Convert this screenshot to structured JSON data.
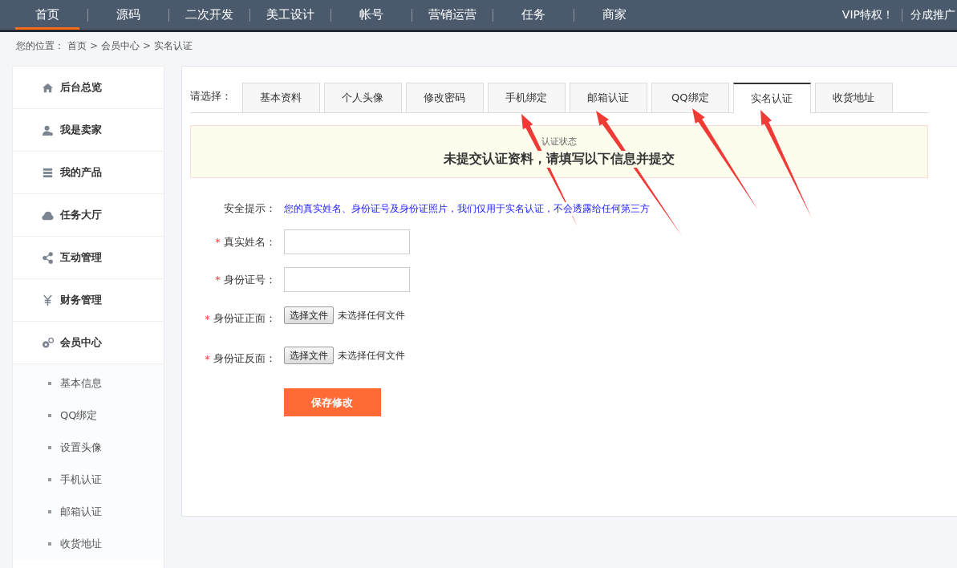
{
  "top_nav": {
    "items": [
      {
        "label": "首页",
        "selected": true
      },
      {
        "label": "源码",
        "selected": false
      },
      {
        "label": "二次开发",
        "selected": false
      },
      {
        "label": "美工设计",
        "selected": false
      },
      {
        "label": "帐号",
        "selected": false
      },
      {
        "label": "营销运营",
        "selected": false
      },
      {
        "label": "任务",
        "selected": false
      },
      {
        "label": "商家",
        "selected": false
      }
    ],
    "right_items": [
      "VIP特权！",
      "分成推广"
    ]
  },
  "breadcrumb": {
    "prefix": "您的位置：",
    "items": [
      "首页",
      "会员中心",
      "实名认证"
    ],
    "separator": ">"
  },
  "sidebar": {
    "items": [
      {
        "label": "后台总览",
        "kind": "home"
      },
      {
        "label": "我是卖家",
        "kind": "user"
      },
      {
        "label": "我的产品",
        "kind": "list"
      },
      {
        "label": "任务大厅",
        "kind": "cloud"
      },
      {
        "label": "互动管理",
        "kind": "share"
      },
      {
        "label": "财务管理",
        "kind": "yen"
      },
      {
        "label": "会员中心",
        "kind": "gears"
      }
    ],
    "sub_items": [
      "基本信息",
      "QQ绑定",
      "设置头像",
      "手机认证",
      "邮箱认证",
      "收货地址"
    ]
  },
  "tabs": {
    "label": "请选择：",
    "items": [
      {
        "label": "基本资料",
        "selected": false
      },
      {
        "label": "个人头像",
        "selected": false
      },
      {
        "label": "修改密码",
        "selected": false
      },
      {
        "label": "手机绑定",
        "selected": false
      },
      {
        "label": "邮箱认证",
        "selected": false
      },
      {
        "label": "QQ绑定",
        "selected": false
      },
      {
        "label": "实名认证",
        "selected": true
      },
      {
        "label": "收货地址",
        "selected": false
      }
    ]
  },
  "status_box": {
    "caption": "认证状态",
    "message": "未提交认证资料，请填写以下信息并提交"
  },
  "notice": {
    "label": "安全提示：",
    "text": "您的真实姓名、身份证号及身份证照片，我们仅用于实名认证，不会透露给任何第三方"
  },
  "form": {
    "fields": [
      {
        "kind": "text",
        "label": "真实姓名：",
        "required": true
      },
      {
        "kind": "text",
        "label": "身份证号：",
        "required": true
      },
      {
        "kind": "file",
        "label": "身份证正面：",
        "required": true,
        "button": "选择文件",
        "status": "未选择任何文件"
      },
      {
        "kind": "file",
        "label": "身份证反面：",
        "required": true,
        "button": "选择文件",
        "status": "未选择任何文件"
      }
    ],
    "required_mark": "*",
    "submit": "保存修改"
  }
}
